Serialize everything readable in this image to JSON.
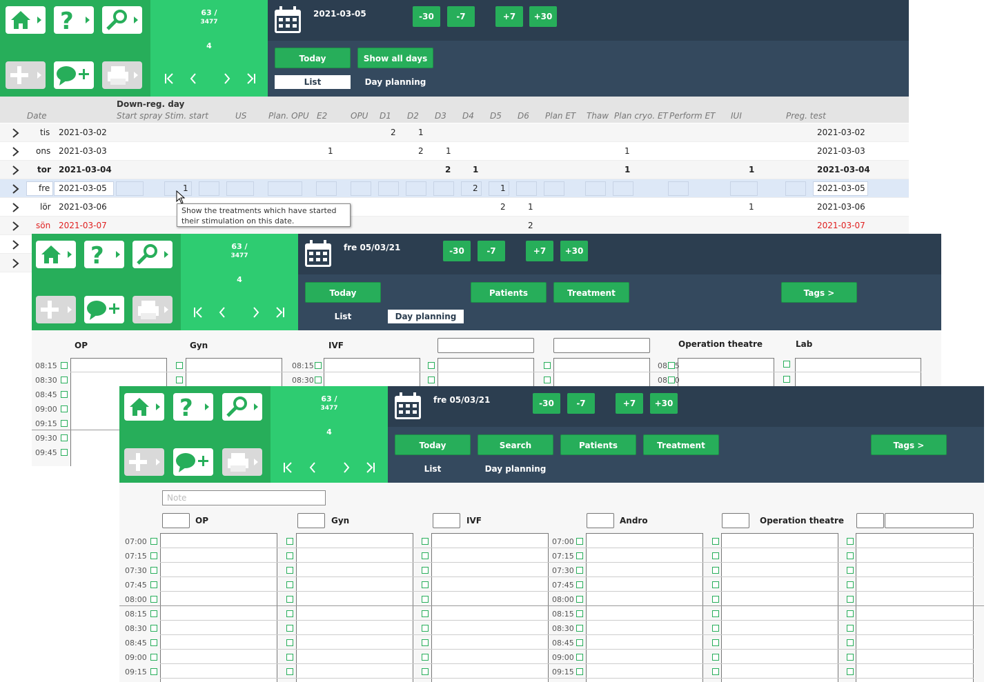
{
  "colors": {
    "green_dark": "#27ae5a",
    "green_light": "#2ecc71",
    "navy": "#2c3e50",
    "slate": "#34495e",
    "weekend_red": "#e02020"
  },
  "icons": [
    "home-icon",
    "help-icon",
    "search-icon",
    "add-icon",
    "add-comment-icon",
    "print-icon",
    "calendar-icon",
    "first-page-icon",
    "prev-icon",
    "next-icon",
    "last-page-icon",
    "chevron-right-icon"
  ],
  "counter": {
    "line1": "63 /",
    "line2": "3477",
    "line3": "4"
  },
  "nav": {
    "first": "|<",
    "prev": "<",
    "next": ">",
    "last": ">|"
  },
  "shift": {
    "m30": "-30",
    "m7": "-7",
    "p7": "+7",
    "p30": "+30"
  },
  "win1": {
    "date": "2021-03-05",
    "today": "Today",
    "show_all": "Show all days",
    "tab_list": "List",
    "tab_day": "Day planning",
    "header_group": "Down-reg. day",
    "headers": [
      "Date",
      "Start spray",
      "Stim. start",
      "US",
      "Plan. OPU",
      "E2",
      "OPU",
      "D1",
      "D2",
      "D3",
      "D4",
      "D5",
      "D6",
      "Plan ET",
      "Thaw",
      "Plan cryo. ET",
      "Perform ET",
      "IUI",
      "Preg. test"
    ],
    "rows": [
      {
        "day": "tis",
        "date": "2021-03-02",
        "d1": "2",
        "d2": "1",
        "preg": "2021-03-02"
      },
      {
        "day": "ons",
        "date": "2021-03-03",
        "e2": "1",
        "d2": "2",
        "d3": "1",
        "cryo": "1",
        "preg": "2021-03-03"
      },
      {
        "day": "tor",
        "date": "2021-03-04",
        "d3": "2",
        "d4": "1",
        "cryo": "1",
        "iui": "1",
        "preg": "2021-03-04"
      },
      {
        "day": "fre",
        "date": "2021-03-05",
        "stim": "1",
        "d4": "2",
        "d5": "1",
        "preg": "2021-03-05"
      },
      {
        "day": "lör",
        "date": "2021-03-06",
        "d5": "2",
        "d6": "1",
        "iui": "1",
        "preg": "2021-03-06"
      },
      {
        "day": "sön",
        "date": "2021-03-07",
        "d6": "2",
        "preg": "2021-03-07"
      }
    ],
    "tooltip": "Show the treatments which have started their stimulation on this date."
  },
  "win2": {
    "date": "fre 05/03/21",
    "today": "Today",
    "patients": "Patients",
    "treatment": "Treatment",
    "tags": "Tags >",
    "tab_list": "List",
    "tab_day": "Day planning",
    "cols": [
      "OP",
      "Gyn",
      "IVF",
      "Operation theatre",
      "Lab"
    ],
    "times": [
      "08:15",
      "08:30",
      "08:45",
      "09:00",
      "09:15",
      "09:30",
      "09:45"
    ]
  },
  "win3": {
    "date": "fre 05/03/21",
    "today": "Today",
    "search": "Search",
    "patients": "Patients",
    "treatment": "Treatment",
    "tags": "Tags >",
    "tab_list": "List",
    "tab_day": "Day planning",
    "note_placeholder": "Note",
    "cols": [
      "OP",
      "Gyn",
      "IVF",
      "Andro",
      "Operation theatre"
    ],
    "times": [
      "07:00",
      "07:15",
      "07:30",
      "07:45",
      "08:00",
      "08:15",
      "08:30",
      "08:45",
      "09:00",
      "09:15"
    ]
  }
}
